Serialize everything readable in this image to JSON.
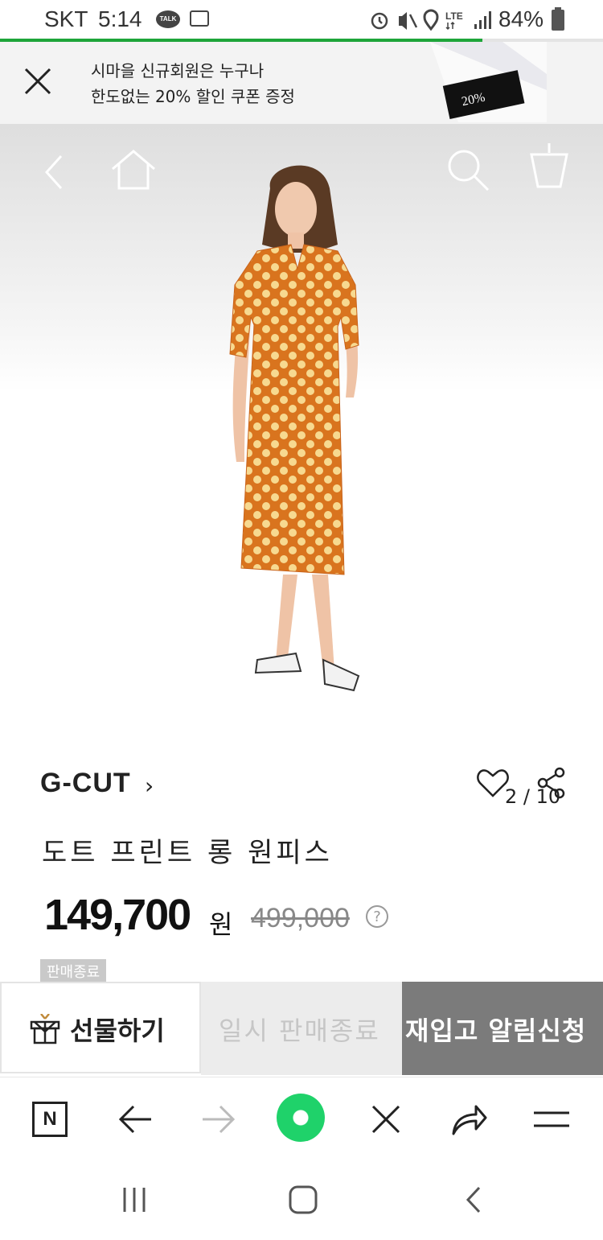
{
  "status_bar": {
    "carrier": "SKT",
    "time": "5:14",
    "talk_badge": "TALK",
    "lte": "LTE",
    "battery": "84%",
    "icons": [
      "kakaotalk-icon",
      "gallery-icon",
      "alarm-icon",
      "mute-icon",
      "location-icon",
      "signal-icon",
      "battery-icon"
    ]
  },
  "promo_banner": {
    "line1": "시마을 신규회원은 누구나",
    "line2": "한도없는 20% 할인 쿠폰 증정",
    "coupon_value": "20%"
  },
  "gallery": {
    "counter": "2 / 10"
  },
  "product": {
    "brand": "G-CUT",
    "brand_chevron": "›",
    "title": "도트 프린트 롱 원피스",
    "price": "149,700",
    "price_unit": "원",
    "original_price": "499,000",
    "price_help": "?",
    "status_badge": "판매종료"
  },
  "actions": {
    "gift": "선물하기",
    "paused": "일시 판매종료",
    "restock": "재입고 알림신청"
  },
  "colors": {
    "accent_green": "#1ea53a",
    "dress_orange": "#d9741e",
    "restock_bg": "#7b7b7b"
  }
}
